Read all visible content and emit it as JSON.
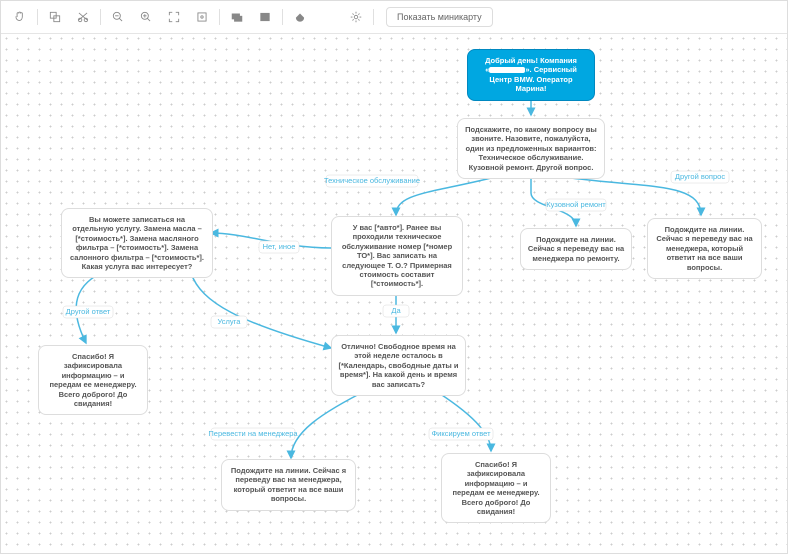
{
  "toolbar": {
    "minimap": "Показать миникарту"
  },
  "nodes": {
    "root": {
      "l1": "Добрый день! Компания",
      "l2": "«",
      "l3": "». Сервисный",
      "l4": "Центр BMW. Оператор",
      "l5": "Марина!"
    },
    "q": "Подскажите, по какому вопросу вы звоните. Назовите, пожалуйста, один из предложенных вариантов: Техническое обслуживание. Кузовной ремонт. Другой вопрос.",
    "to": "У вас [*авто*]. Ранее вы проходили техническое обслуживание номер [*номер ТО*]. Вас записать на следующее Т. О.? Примерная стоимость составит [*стоимость*].",
    "kuz": "Подождите на линии. Сейчас я переведу вас на менеджера по ремонту.",
    "other": "Подождите на линии. Сейчас я переведу вас на менеджера, который ответит на все ваши вопросы.",
    "serv": "Вы можете записаться на отдельную услугу. Замена масла – [*стоимость*]. Замена масляного фильтра – [*стоимость*]. Замена салонного фильтра – [*стоимость*]. Какая услуга вас интересует?",
    "ok": "Отлично! Свободное время на этой неделе осталось в [*Календарь, свободные даты и время*]. На какой день и время вас записать?",
    "thx": "Спасибо! Я зафиксировала информацию – и передам ее менеджеру. Всего доброго! До свидания!",
    "fix": "Спасибо! Я зафиксировала информацию – и передам ее менеджеру. Всего доброго! До свидания!",
    "mgr": "Подождите на линии. Сейчас я переведу вас на менеджера, который ответит на все ваши вопросы."
  },
  "edges": {
    "to": "Техническое обслуживание",
    "kuz": "Кузовной ремонт",
    "other": "Другой вопрос",
    "no": "Нет, иное",
    "yes": "Да",
    "serv": "Услуга",
    "ans": "Другой ответ",
    "mgr": "Перевести на менеджера",
    "fix": "Фиксируем ответ"
  }
}
